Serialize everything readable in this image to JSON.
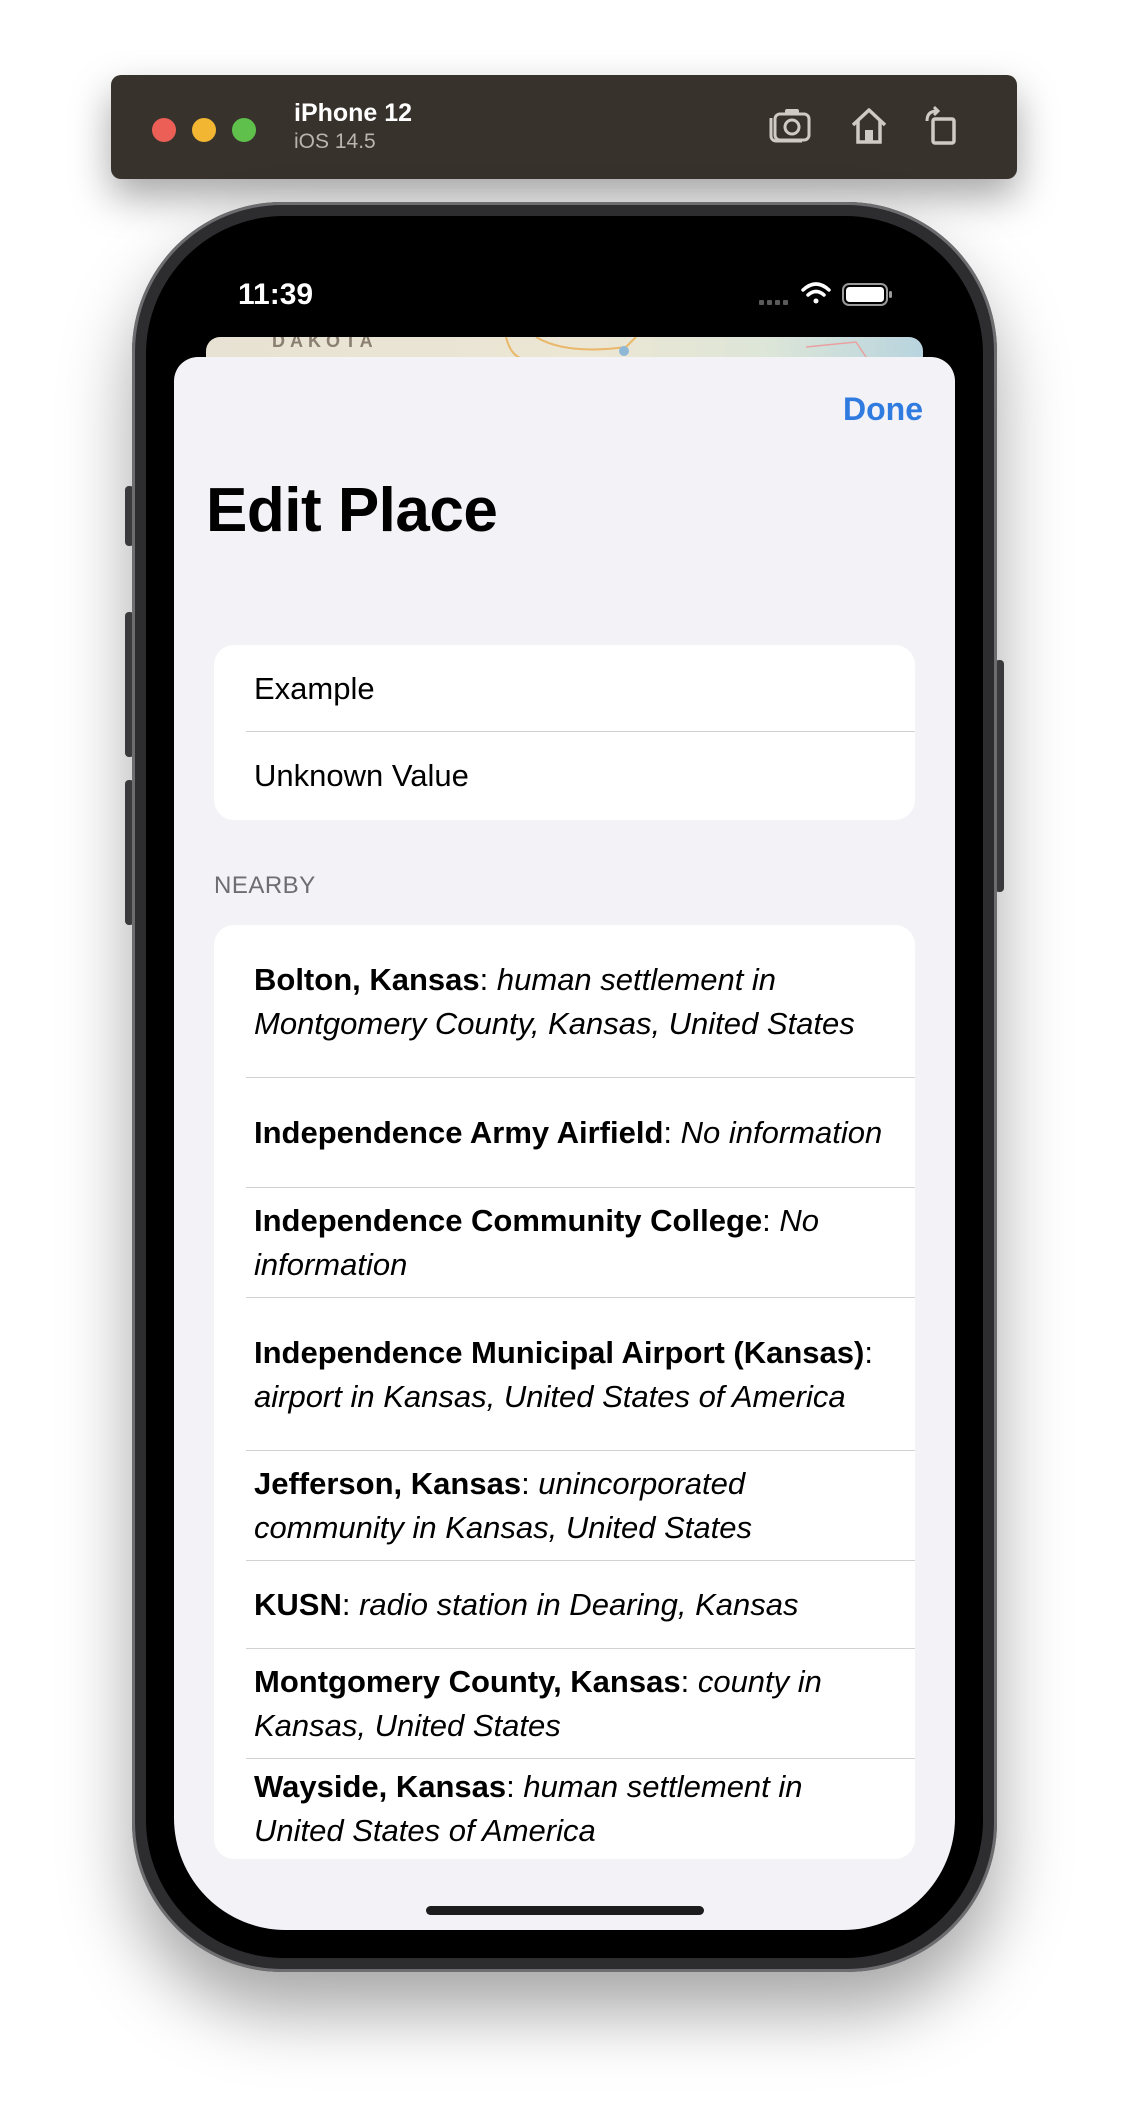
{
  "simulator": {
    "device_name": "iPhone 12",
    "os_version": "iOS 14.5",
    "toolbar_icons": [
      "screenshot-icon",
      "home-icon",
      "rotate-icon"
    ]
  },
  "status_bar": {
    "time": "11:39",
    "icons": [
      "cellular-icon",
      "wifi-icon",
      "battery-icon"
    ]
  },
  "map": {
    "label": "DAKOTA"
  },
  "sheet": {
    "done_label": "Done",
    "title": "Edit Place",
    "info_rows": [
      "Example",
      "Unknown Value"
    ],
    "nearby_header": "NEARBY",
    "nearby": [
      {
        "name": "Bolton, Kansas",
        "description": "human settlement in Montgomery County, Kansas, United States"
      },
      {
        "name": "Independence Army Airfield",
        "description": "No information"
      },
      {
        "name": "Independence Community College",
        "description": "No information"
      },
      {
        "name": "Independence Municipal Airport (Kansas)",
        "description": "airport in Kansas, United States of America"
      },
      {
        "name": "Jefferson, Kansas",
        "description": "unincorporated community in Kansas, United States"
      },
      {
        "name": "KUSN",
        "description": "radio station in Dearing, Kansas"
      },
      {
        "name": "Montgomery County, Kansas",
        "description": "county in Kansas, United States"
      },
      {
        "name": "Wayside, Kansas",
        "description": "human settlement in United States of America"
      }
    ]
  },
  "colors": {
    "accent": "#2f7be0",
    "sheet_background": "#f2f2f7",
    "toolbar": "#37322c"
  }
}
